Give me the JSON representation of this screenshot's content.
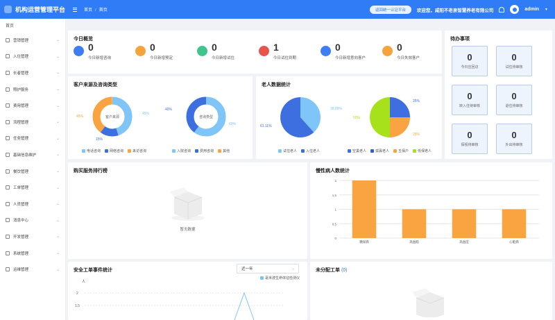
{
  "app": {
    "title": "机构运营管理平台"
  },
  "header": {
    "breadcrumb": [
      "首页",
      "首页"
    ],
    "return_btn": "返回统一认证平台",
    "welcome": "欢迎您，咸阳不老泉智慧养老有限公司",
    "user": "admin"
  },
  "sidebar": {
    "title": "首页",
    "items": [
      {
        "label": "营销管理",
        "icon": "marketing-icon"
      },
      {
        "label": "入住管理",
        "icon": "checkin-icon"
      },
      {
        "label": "长者管理",
        "icon": "elder-icon"
      },
      {
        "label": "照护服务",
        "icon": "care-icon"
      },
      {
        "label": "费用管理",
        "icon": "fee-icon"
      },
      {
        "label": "流程管理",
        "icon": "flow-icon"
      },
      {
        "label": "任务管理",
        "icon": "task-icon"
      },
      {
        "label": "基础信息维护",
        "icon": "base-info-icon"
      },
      {
        "label": "餐饮管理",
        "icon": "catering-icon"
      },
      {
        "label": "工单管理",
        "icon": "workorder-icon"
      },
      {
        "label": "人员管理",
        "icon": "staff-icon"
      },
      {
        "label": "消息中心",
        "icon": "message-icon"
      },
      {
        "label": "开发管理",
        "icon": "dev-icon"
      },
      {
        "label": "系统管理",
        "icon": "system-icon"
      },
      {
        "label": "运维管理",
        "icon": "ops-icon"
      }
    ]
  },
  "overview": {
    "title": "今日概览",
    "stats": [
      {
        "value": "0",
        "label": "今日新增咨询",
        "color": "#3d7ef5"
      },
      {
        "value": "0",
        "label": "今日新增预定",
        "color": "#f5a33d"
      },
      {
        "value": "0",
        "label": "今日新增试住",
        "color": "#3fc58d"
      },
      {
        "value": "1",
        "label": "今日试住到期",
        "color": "#e8534a"
      },
      {
        "value": "0",
        "label": "今日新增意向客户",
        "color": "#3d7ef5"
      },
      {
        "value": "0",
        "label": "今日失效客户",
        "color": "#f5a33d"
      }
    ]
  },
  "todo": {
    "title": "待办事项",
    "items": [
      {
        "value": "0",
        "label": "今日应回访"
      },
      {
        "value": "0",
        "label": "试住待审核"
      },
      {
        "value": "0",
        "label": "转入住待审核"
      },
      {
        "value": "0",
        "label": "退住待审核"
      },
      {
        "value": "0",
        "label": "探视待审核"
      },
      {
        "value": "0",
        "label": "外出待审核"
      }
    ]
  },
  "customer_source": {
    "title": "客户来源及咨询类型",
    "donut1": {
      "center": "客户来源",
      "labels": [
        "45%",
        "45%",
        "15%"
      ]
    },
    "donut2": {
      "center": "咨询类型",
      "labels": [
        "40%",
        "60%"
      ]
    },
    "legend1": [
      "电话咨询",
      "网络咨询",
      "来访咨询"
    ],
    "legend2": [
      "入院咨询",
      "费用咨询",
      "其他"
    ]
  },
  "elder_stats": {
    "title": "老人数据统计",
    "pie1_labels": [
      "38.89%",
      "61.11%"
    ],
    "pie2_labels": [
      "25%",
      "50%",
      "25%"
    ],
    "legend1": [
      "试住老人",
      "入住老人"
    ],
    "legend2": [
      "空巢老人",
      "孤寡老人",
      "五保户",
      "低保老人"
    ]
  },
  "purchase": {
    "title": "购买服务排行榜",
    "empty": "暂无数据"
  },
  "chart_data": [
    {
      "type": "bar",
      "title": "慢性病人数统计",
      "categories": [
        "糖尿病",
        "高血脂",
        "高血压",
        "心脏病"
      ],
      "values": [
        2,
        1,
        1,
        1
      ],
      "ylim": [
        0,
        2
      ],
      "yticks": [
        "0",
        "0.5",
        "1",
        "1.5",
        "2"
      ],
      "color": "#f9a441"
    },
    {
      "type": "line",
      "title": "安全工单事件统计",
      "ylabel": "人",
      "series": [
        {
          "name": "毫米波生命体征检测仪"
        }
      ],
      "yticks": [
        "2",
        "1.5"
      ]
    }
  ],
  "safety": {
    "title": "安全工单事件统计",
    "select": "近一年",
    "ylabel": "人",
    "legend": "毫米波生命体征检测仪"
  },
  "unassigned": {
    "title": "未分配工单",
    "count": "(0)"
  },
  "colors": {
    "primary": "#2f7cf6",
    "orange": "#f9a441",
    "lightblue": "#7fc5f7",
    "blue": "#3d6fe0",
    "green": "#a6e11c"
  }
}
